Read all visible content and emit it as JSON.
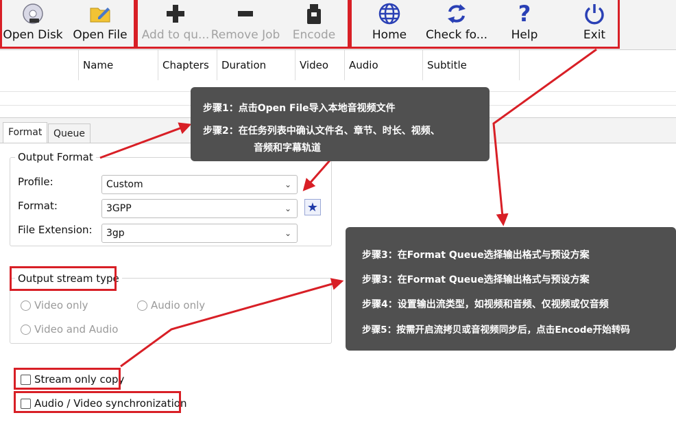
{
  "toolbar": {
    "open_disk": "Open Disk",
    "open_file": "Open File",
    "add_queue": "Add to qu...",
    "remove_job": "Remove Job",
    "encode": "Encode",
    "home": "Home",
    "check_updates": "Check fo...",
    "help": "Help",
    "exit": "Exit",
    "accent_colors": {
      "home": "#2a40b5",
      "check": "#2a40b5",
      "help": "#2a40b5",
      "exit": "#2a40b5"
    }
  },
  "table": {
    "columns": [
      "Name",
      "Chapters",
      "Duration",
      "Video",
      "Audio",
      "Subtitle"
    ],
    "rows": []
  },
  "tabs": [
    "Format",
    "Queue"
  ],
  "output_format": {
    "title": "Output Format",
    "profile_label": "Profile:",
    "profile_value": "Custom",
    "format_label": "Format:",
    "format_value": "3GPP",
    "ext_label": "File Extension:",
    "ext_value": "3gp"
  },
  "stream_type": {
    "title": "Output stream type",
    "video_only": "Video only",
    "audio_only": "Audio only",
    "video_audio": "Video and Audio"
  },
  "checks": {
    "stream_copy": "Stream only copy",
    "av_sync": "Audio / Video synchronization"
  },
  "callouts": {
    "top": {
      "line1": "步骤1：点击Open File导入本地音视频文件",
      "line2": "步骤2：在任务列表中确认文件名、章节、时长、视频、",
      "line3": "音频和字幕轨道"
    },
    "right": {
      "line1": "步骤3：在Format Queue选择输出格式与预设方案",
      "line2": "步骤3：在Format Queue选择输出格式与预设方案",
      "line3": "步骤4：设置输出流类型，如视频和音频、仅视频或仅音频",
      "line4": "步骤5：按需开启流拷贝或音视频同步后，点击Encode开始转码"
    }
  },
  "colors": {
    "highlight": "#d81f26",
    "callout_bg": "#505050"
  }
}
